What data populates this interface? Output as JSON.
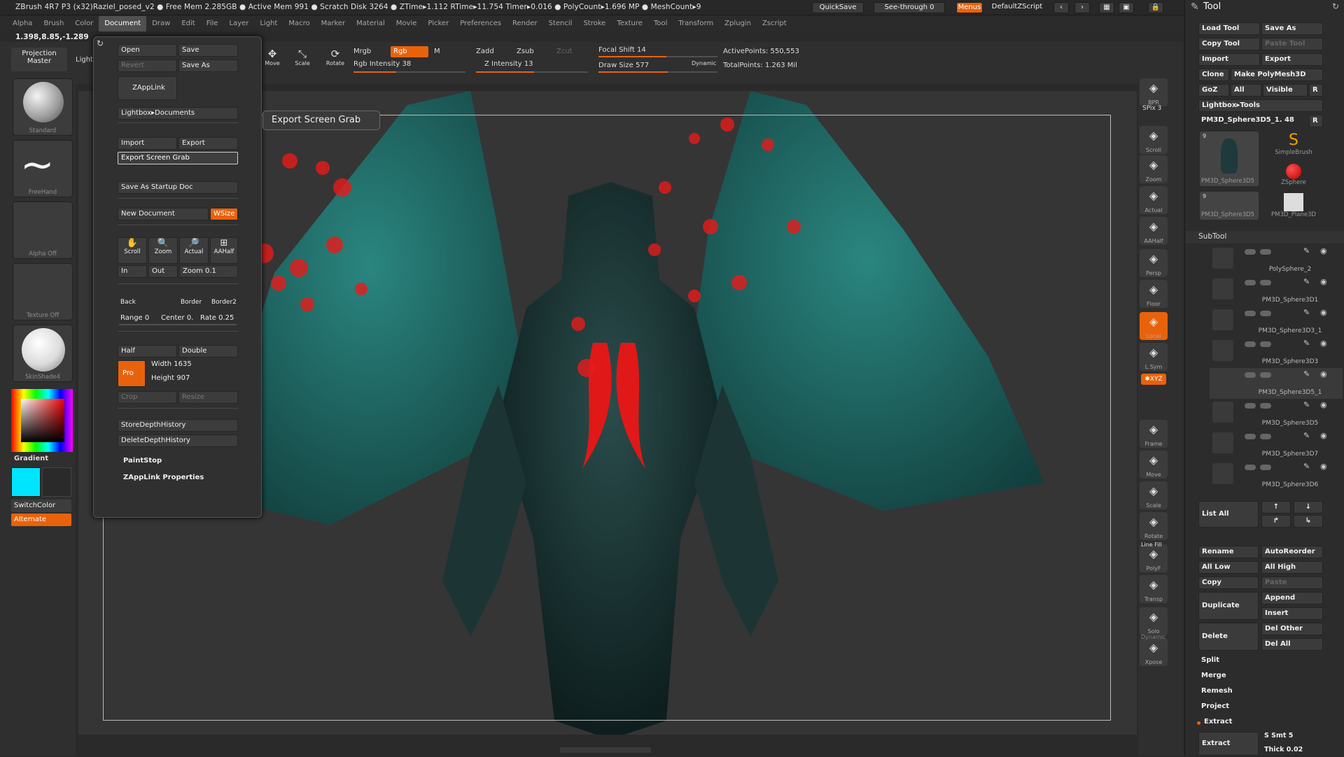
{
  "app": {
    "title": "ZBrush 4R7 P3 (x32)Raziel_posed_v2  ● Free Mem 2.285GB ● Active Mem 991 ● Scratch Disk 3264 ●  ZTime▸1.112 RTime▸11.754 Timer▸0.016 ● PolyCount▸1.696 MP  ● MeshCount▸9",
    "quicksave": "QuickSave",
    "see_through": "See-through  0",
    "menus": "Menus",
    "default_zscript": "DefaultZScript",
    "coords": "1.398,8.85,-1.289"
  },
  "menubar": [
    "Alpha",
    "Brush",
    "Color",
    "Document",
    "Draw",
    "Edit",
    "File",
    "Layer",
    "Light",
    "Macro",
    "Marker",
    "Material",
    "Movie",
    "Picker",
    "Preferences",
    "Render",
    "Stencil",
    "Stroke",
    "Texture",
    "Tool",
    "Transform",
    "Zplugin",
    "Zscript"
  ],
  "topshelf": {
    "projection_master": "Projection Master",
    "lightbox": "LightBox",
    "move": "Move",
    "scale": "Scale",
    "rotate": "Rotate",
    "mrgb": "Mrgb",
    "rgb": "Rgb",
    "m": "M",
    "rgb_intensity": "Rgb Intensity 38",
    "zadd": "Zadd",
    "zsub": "Zsub",
    "zcut": "Zcut",
    "z_intensity": "Z Intensity 13",
    "focal_shift": "Focal Shift 14",
    "draw_size": "Draw Size 577",
    "dynamic": "Dynamic",
    "active_points": "ActivePoints: 550,553",
    "total_points": "TotalPoints: 1.263  Mil"
  },
  "leftshelf": {
    "standard": "Standard",
    "freehand": "FreeHand",
    "alpha_off": "Alpha  Off",
    "texture_off": "Texture  Off",
    "material": "SkinShade4",
    "gradient": "Gradient",
    "switchcolor": "SwitchColor",
    "alternate": "Alternate",
    "colors": {
      "main": "#00e5ff",
      "secondary": "#2a2a2a"
    }
  },
  "document_panel": {
    "open": "Open",
    "save": "Save",
    "revert": "Revert",
    "save_as": "Save As",
    "zapplink": "ZAppLink",
    "lightbox_documents": "Lightbox▸Documents",
    "import": "Import",
    "export": "Export",
    "export_screen_grab": "Export Screen Grab",
    "save_startup": "Save As Startup Doc",
    "new_document": "New Document",
    "wsize": "WSize",
    "scroll": "Scroll",
    "zoom": "Zoom",
    "actual": "Actual",
    "aahalf": "AAHalf",
    "in": "In",
    "out": "Out",
    "zoom_val": "Zoom 0.1",
    "back": "Back",
    "border": "Border",
    "border2": "Border2",
    "range": "Range 0",
    "center": "Center 0.",
    "rate": "Rate 0.25",
    "half": "Half",
    "double": "Double",
    "pro": "Pro",
    "width": "Width 1635",
    "height": "Height 907",
    "crop": "Crop",
    "resize": "Resize",
    "store_depth": "StoreDepthHistory",
    "delete_depth": "DeleteDepthHistory",
    "paintstop": "PaintStop",
    "zapplink_props": "ZAppLink Properties"
  },
  "tooltip": "Export Screen Grab",
  "rightshelf": [
    {
      "label": "BPR",
      "icon": "bpr-icon"
    },
    {
      "label": "SPix 3",
      "icon": ""
    },
    {
      "label": "Scroll",
      "icon": "scroll-icon"
    },
    {
      "label": "Zoom",
      "icon": "zoom-icon"
    },
    {
      "label": "Actual",
      "icon": "actual-icon"
    },
    {
      "label": "AAHalf",
      "icon": "aahalf-icon"
    },
    {
      "label": "Persp",
      "icon": "persp-icon"
    },
    {
      "label": "Floor",
      "icon": "floor-icon"
    },
    {
      "label": "Local",
      "icon": "local-icon"
    },
    {
      "label": "L.Sym",
      "icon": "lsym-icon"
    },
    {
      "label": "Frame",
      "icon": "frame-icon"
    },
    {
      "label": "Move",
      "icon": "move-icon"
    },
    {
      "label": "Scale",
      "icon": "scale-icon"
    },
    {
      "label": "Rotate",
      "icon": "rotate-icon"
    },
    {
      "label": "PolyF",
      "icon": "polyf-icon"
    },
    {
      "label": "Transp",
      "icon": "transp-icon"
    },
    {
      "label": "Solo",
      "icon": "solo-icon"
    },
    {
      "label": "Xpose",
      "icon": "xpose-icon"
    }
  ],
  "rightshelf_extra": {
    "dynamic": "Dynamic",
    "line_fill": "Line Fill",
    "xyz": "✱XYZ"
  },
  "toolpanel": {
    "title": "Tool",
    "load_tool": "Load Tool",
    "save_as": "Save As",
    "copy_tool": "Copy Tool",
    "paste_tool": "Paste Tool",
    "import": "Import",
    "export": "Export",
    "clone": "Clone",
    "make_polymesh": "Make PolyMesh3D",
    "goz": "GoZ",
    "all": "All",
    "visible": "Visible",
    "r": "R",
    "lightbox_tools": "Lightbox▸Tools",
    "current_tool": "PM3D_Sphere3D5_1. 48",
    "thumbs": [
      {
        "label": "PM3D_Sphere3D5",
        "badge": "9"
      },
      {
        "label": "SimpleBrush",
        "badge": ""
      },
      {
        "label": "ZSphere",
        "badge": ""
      },
      {
        "label": "PM3D_Sphere3D5",
        "badge": "9"
      },
      {
        "label": "PM3D_Plane3D",
        "badge": ""
      }
    ],
    "subtool_title": "SubTool",
    "subtools": [
      "PolySphere_2",
      "PM3D_Sphere3D1",
      "PM3D_Sphere3D3_1",
      "PM3D_Sphere3D3",
      "PM3D_Sphere3D5_1",
      "PM3D_Sphere3D5",
      "PM3D_Sphere3D7",
      "PM3D_Sphere3D6"
    ],
    "list_all": "List  All",
    "rename": "Rename",
    "autoreorder": "AutoReorder",
    "all_low": "All Low",
    "all_high": "All High",
    "copy": "Copy",
    "paste": "Paste",
    "duplicate": "Duplicate",
    "append": "Append",
    "insert": "Insert",
    "delete": "Delete",
    "del_other": "Del Other",
    "del_all": "Del All",
    "split": "Split",
    "merge": "Merge",
    "remesh": "Remesh",
    "project": "Project",
    "extract_section": "Extract",
    "extract_btn": "Extract",
    "s_smt": "S Smt 5",
    "thick": "Thick 0.02"
  }
}
